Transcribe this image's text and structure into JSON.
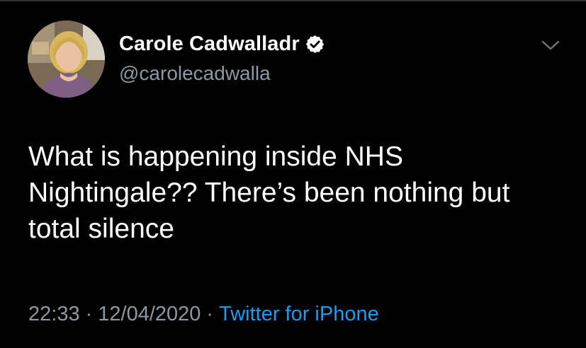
{
  "user": {
    "display_name": "Carole Cadwalladr",
    "handle": "@carolecadwalla",
    "verified": true
  },
  "tweet": {
    "text": "What is happening inside NHS Nightingale?? There’s been nothing but total silence",
    "time": "22:33",
    "date": "12/04/2020",
    "separator": "·",
    "source": "Twitter for iPhone"
  },
  "icons": {
    "verified": "verified-badge-icon",
    "menu": "chevron-down-icon"
  },
  "colors": {
    "background": "#000000",
    "primary_text": "#ffffff",
    "secondary_text": "#8b98a5",
    "link": "#1d9bf0"
  }
}
